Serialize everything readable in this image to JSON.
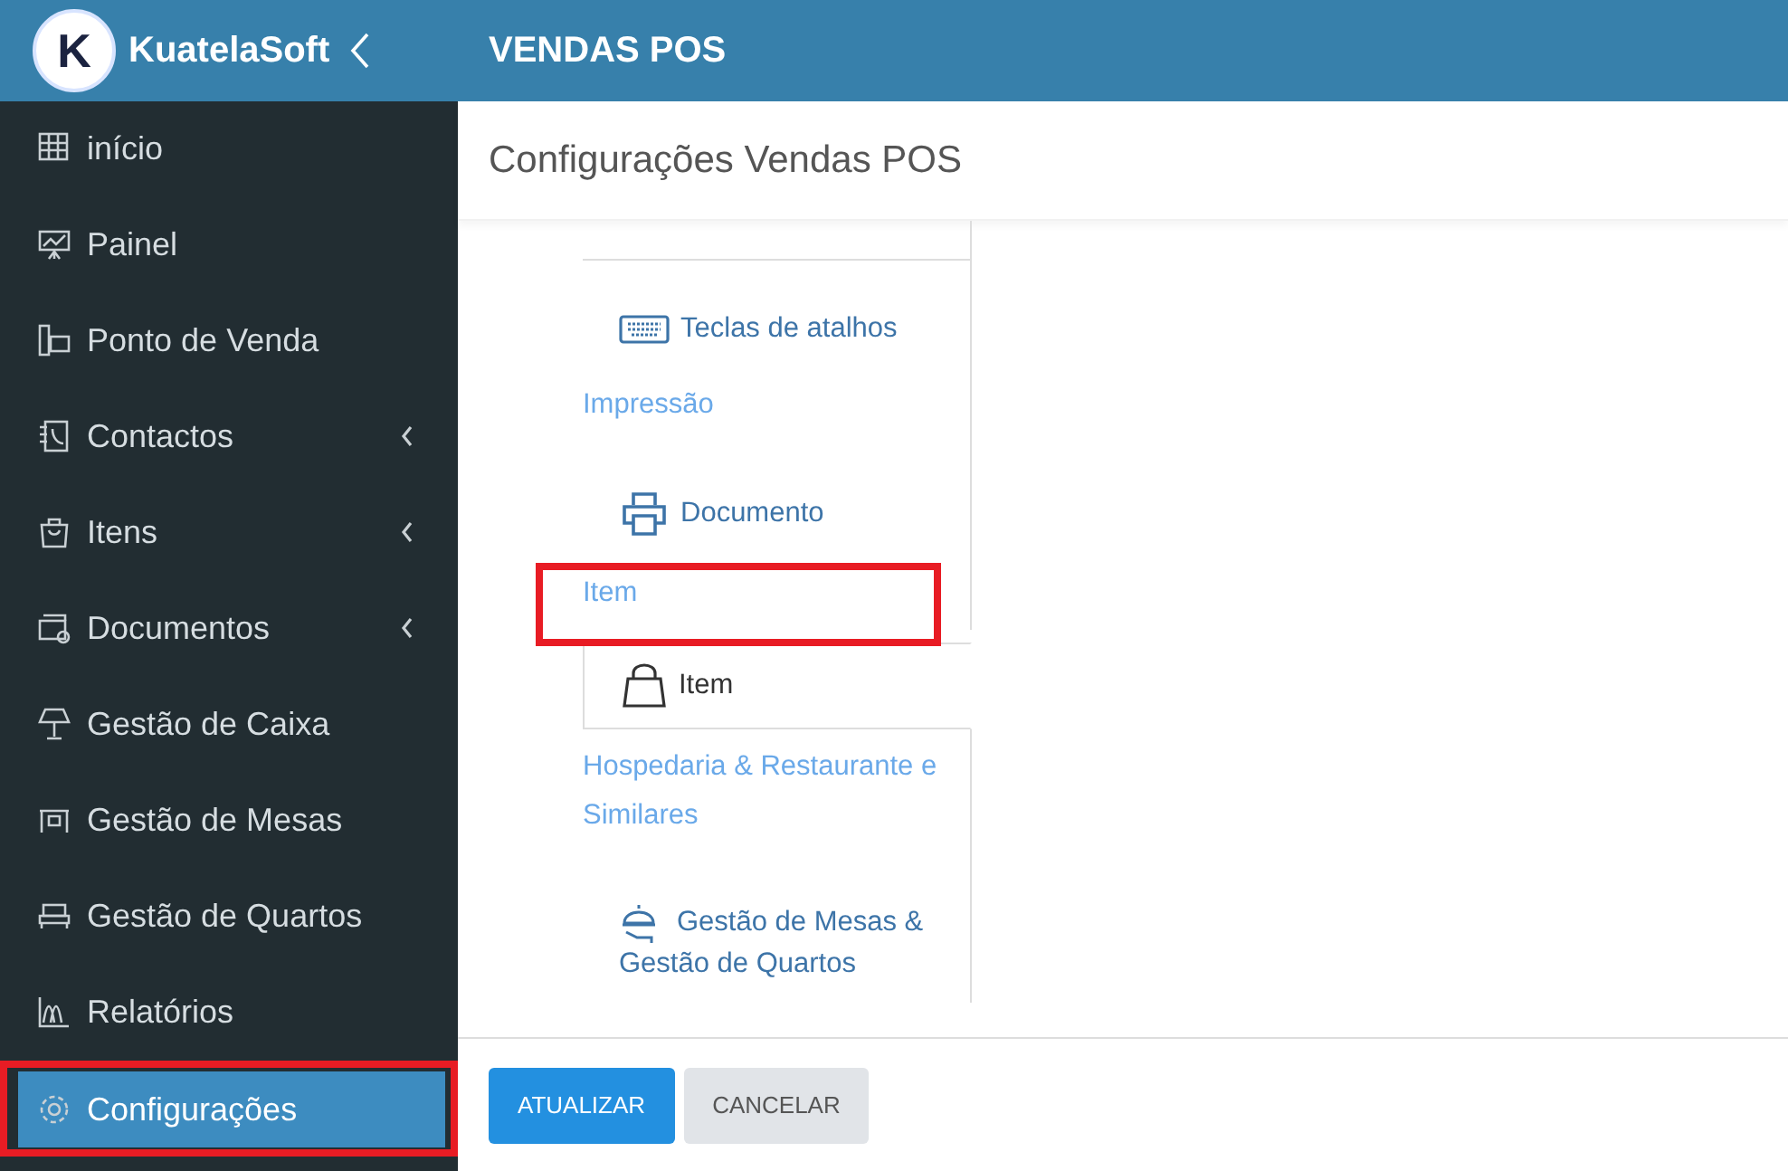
{
  "brand": {
    "name": "KuatelaSoft",
    "logo_letter": "K"
  },
  "page_title": "VENDAS POS",
  "sidebar": {
    "items": [
      {
        "label": "início",
        "has_submenu": false,
        "selected": false,
        "highlighted": false
      },
      {
        "label": "Painel",
        "has_submenu": false,
        "selected": false,
        "highlighted": false
      },
      {
        "label": "Ponto de Venda",
        "has_submenu": false,
        "selected": false,
        "highlighted": false
      },
      {
        "label": "Contactos",
        "has_submenu": true,
        "selected": false,
        "highlighted": false
      },
      {
        "label": "Itens",
        "has_submenu": true,
        "selected": false,
        "highlighted": false
      },
      {
        "label": "Documentos",
        "has_submenu": true,
        "selected": false,
        "highlighted": false
      },
      {
        "label": "Gestão de Caixa",
        "has_submenu": false,
        "selected": false,
        "highlighted": false
      },
      {
        "label": "Gestão de Mesas",
        "has_submenu": false,
        "selected": false,
        "highlighted": false
      },
      {
        "label": "Gestão de Quartos",
        "has_submenu": false,
        "selected": false,
        "highlighted": false
      },
      {
        "label": "Relatórios",
        "has_submenu": false,
        "selected": false,
        "highlighted": false
      },
      {
        "label": "Configurações",
        "has_submenu": false,
        "selected": true,
        "highlighted": true
      }
    ]
  },
  "content_title": "Configurações Vendas POS",
  "settings_tabs": [
    {
      "kind": "tab",
      "label": "Teclas de atalhos",
      "selected": false
    },
    {
      "kind": "group",
      "label": "Impressão",
      "highlighted": false
    },
    {
      "kind": "tab",
      "label": "Documento",
      "selected": false
    },
    {
      "kind": "group",
      "label": "Item",
      "highlighted": true
    },
    {
      "kind": "tab",
      "label": "Item",
      "selected": true
    },
    {
      "kind": "group",
      "label": "Hospedaria & Restaurante e Similares",
      "highlighted": false
    },
    {
      "kind": "tab",
      "label": "Gestão de Mesas & Gestão de Quartos",
      "selected": false
    }
  ],
  "buttons": [
    {
      "label": "ATUALIZAR",
      "kind": "primary"
    },
    {
      "label": "CANCELAR",
      "kind": "secondary"
    }
  ]
}
